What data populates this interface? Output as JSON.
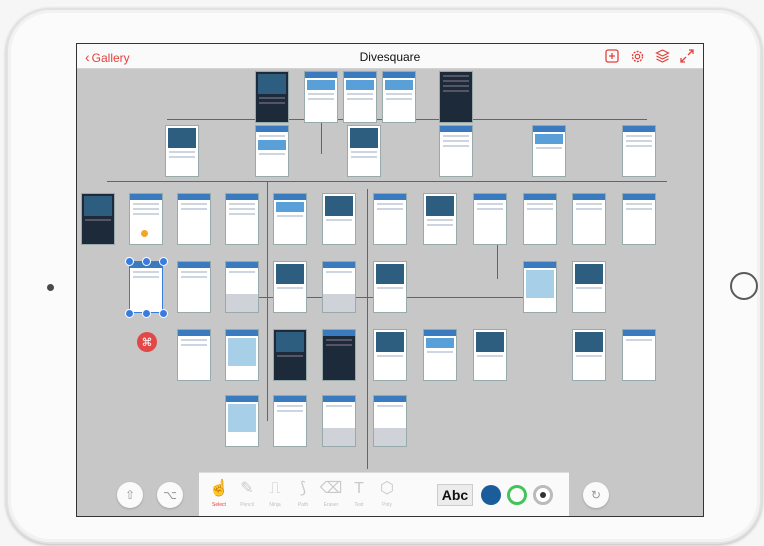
{
  "nav": {
    "back_label": "Gallery"
  },
  "document": {
    "title": "Divesquare"
  },
  "topbar_icons": [
    "add-screen-icon",
    "settings-icon",
    "layers-icon",
    "fullscreen-icon"
  ],
  "toolbar": {
    "tools": [
      {
        "label": "Select",
        "icon": "pointer-icon",
        "active": true
      },
      {
        "label": "Pencil",
        "icon": "pencil-icon",
        "active": false
      },
      {
        "label": "Ninja",
        "icon": "ruler-icon",
        "active": false
      },
      {
        "label": "Path",
        "icon": "path-icon",
        "active": false
      },
      {
        "label": "Eraser",
        "icon": "eraser-icon",
        "active": false
      },
      {
        "label": "Text",
        "icon": "text-icon",
        "active": false
      },
      {
        "label": "Poly",
        "icon": "polygon-icon",
        "active": false
      }
    ],
    "text_style_label": "Abc",
    "fill_color": "#1a5d9a",
    "stroke_color": "#43c45a"
  },
  "canvas": {
    "selected_count_marker": "⌘"
  },
  "colors": {
    "accent": "#e2413b",
    "canvas_bg": "#c7c7c7",
    "wire": "#3c6ea3"
  }
}
